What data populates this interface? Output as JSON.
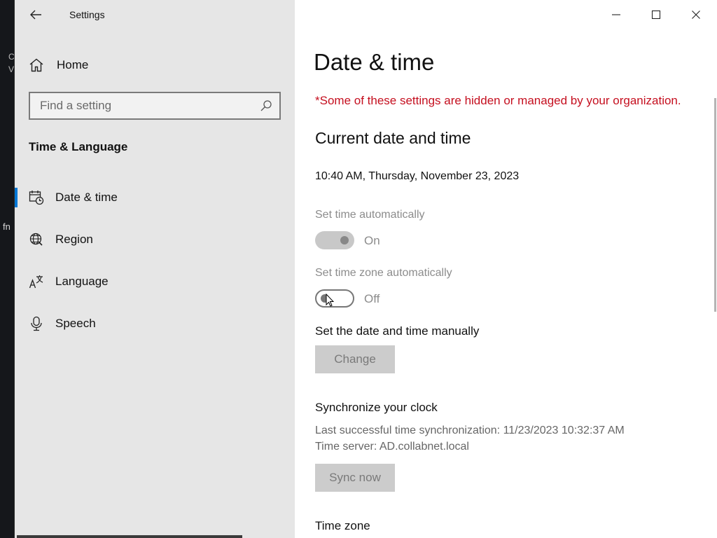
{
  "desktop": {
    "fn_text": "fn",
    "frag1": "C",
    "frag2": "V"
  },
  "window": {
    "title": "Settings",
    "back_icon": "back-arrow-icon",
    "controls": {
      "minimize": "minimize-icon",
      "maximize": "maximize-icon",
      "close": "close-icon"
    }
  },
  "sidebar": {
    "home_label": "Home",
    "home_icon": "home-icon",
    "search_placeholder": "Find a setting",
    "search_icon": "search-icon",
    "section_title": "Time & Language",
    "items": [
      {
        "label": "Date & time",
        "icon": "calendar-clock-icon",
        "active": true
      },
      {
        "label": "Region",
        "icon": "globe-icon",
        "active": false
      },
      {
        "label": "Language",
        "icon": "language-icon",
        "active": false
      },
      {
        "label": "Speech",
        "icon": "microphone-icon",
        "active": false
      }
    ],
    "accent_color": "#0078d7"
  },
  "main": {
    "title": "Date & time",
    "managed_note": "*Some of these settings are hidden or managed by your organization.",
    "managed_note_color": "#c50f1f",
    "current_heading": "Current date and time",
    "current_datetime": "10:40 AM, Thursday, November 23, 2023",
    "auto_time": {
      "label": "Set time automatically",
      "state": "On",
      "enabled": true
    },
    "auto_timezone": {
      "label": "Set time zone automatically",
      "state": "Off",
      "enabled": false
    },
    "manual_heading": "Set the date and time manually",
    "change_button": "Change",
    "sync_heading": "Synchronize your clock",
    "sync_last": "Last successful time synchronization: 11/23/2023 10:32:37 AM",
    "sync_server": "Time server: AD.collabnet.local",
    "sync_button": "Sync now",
    "timezone_heading": "Time zone"
  }
}
